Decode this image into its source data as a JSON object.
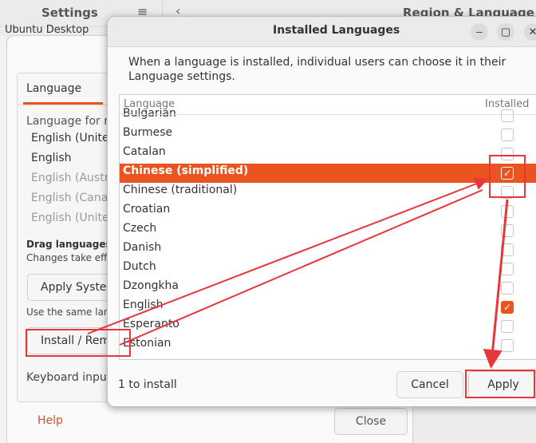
{
  "settings": {
    "title": "Settings",
    "hamburger_icon": "≡",
    "back_icon": "‹",
    "region_title": "Region & Language",
    "ubuntu_desktop": "Ubuntu Desktop"
  },
  "language_dialog": {
    "tab_language": "Language",
    "language_for_menus": "Language for menus",
    "languages": [
      "English (United States)",
      "English",
      "English (Australia)",
      "English (Canada)",
      "English (United Kingdom)"
    ],
    "drag_hint": "Drag languages to arrange them in order of preference.",
    "changes_hint": "Changes take effect next time you log in.",
    "apply_system_wide": "Apply System-Wide",
    "same_language_hint": "Use the same language choices for startup and the login screen.",
    "install_remove": "Install / Remove Languages...",
    "keyboard_input": "Keyboard input method system:",
    "help": "Help",
    "close": "Close"
  },
  "installed_dialog": {
    "title": "Installed Languages",
    "description": "When a language is installed, individual users can choose it in their Language settings.",
    "column_language": "Language",
    "column_installed": "Installed",
    "rows": [
      {
        "name": "Bulgarian",
        "checked": false,
        "selected": false
      },
      {
        "name": "Burmese",
        "checked": false,
        "selected": false
      },
      {
        "name": "Catalan",
        "checked": false,
        "selected": false
      },
      {
        "name": "Chinese (simplified)",
        "checked": true,
        "selected": true
      },
      {
        "name": "Chinese (traditional)",
        "checked": false,
        "selected": false
      },
      {
        "name": "Croatian",
        "checked": false,
        "selected": false
      },
      {
        "name": "Czech",
        "checked": false,
        "selected": false
      },
      {
        "name": "Danish",
        "checked": false,
        "selected": false
      },
      {
        "name": "Dutch",
        "checked": false,
        "selected": false
      },
      {
        "name": "Dzongkha",
        "checked": false,
        "selected": false
      },
      {
        "name": "English",
        "checked": true,
        "selected": false
      },
      {
        "name": "Esperanto",
        "checked": false,
        "selected": false
      },
      {
        "name": "Estonian",
        "checked": false,
        "selected": false
      }
    ],
    "status": "1 to install",
    "cancel": "Cancel",
    "apply": "Apply",
    "minimize_icon": "–",
    "maximize_icon": "▢",
    "close_icon": "✕",
    "check_glyph": "✓"
  },
  "colors": {
    "accent": "#e95420",
    "annotation": "#e8363a"
  }
}
